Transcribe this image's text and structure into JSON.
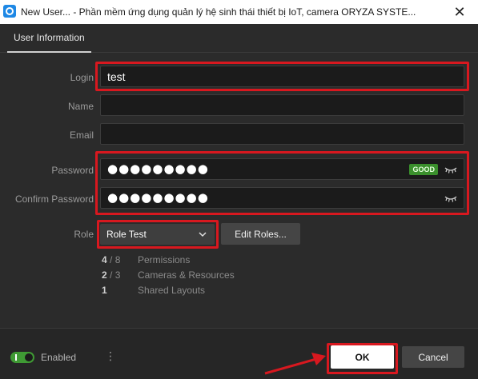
{
  "window": {
    "title": "New User... - Phần mềm ứng dụng quản lý hệ sinh thái thiết bị IoT, camera ORYZA SYSTE...",
    "close_glyph": "✕",
    "app_icon": "app-logo-icon"
  },
  "tabs": [
    {
      "label": "User Information"
    }
  ],
  "form": {
    "login": {
      "label": "Login",
      "value": "test"
    },
    "name": {
      "label": "Name",
      "value": ""
    },
    "email": {
      "label": "Email",
      "value": ""
    },
    "password": {
      "label": "Password",
      "masked": "●●●●●●●●●",
      "strength": "GOOD",
      "strength_color": "#3a8f2c",
      "toggle_icon": "eye-closed-icon"
    },
    "confirm_password": {
      "label": "Confirm Password",
      "masked": "●●●●●●●●●",
      "toggle_icon": "eye-closed-icon"
    },
    "role": {
      "label": "Role",
      "selected": "Role Test",
      "edit_button": "Edit Roles..."
    }
  },
  "role_summary": [
    {
      "count": "4",
      "total": " / 8",
      "label": "Permissions"
    },
    {
      "count": "2",
      "total": " / 3",
      "label": "Cameras & Resources"
    },
    {
      "count": "1",
      "total": "",
      "label": "Shared Layouts"
    }
  ],
  "footer": {
    "enabled_label": "Enabled",
    "enabled": true,
    "more_glyph": "⋮",
    "ok_label": "OK",
    "cancel_label": "Cancel"
  },
  "highlight_color": "#d8181f"
}
